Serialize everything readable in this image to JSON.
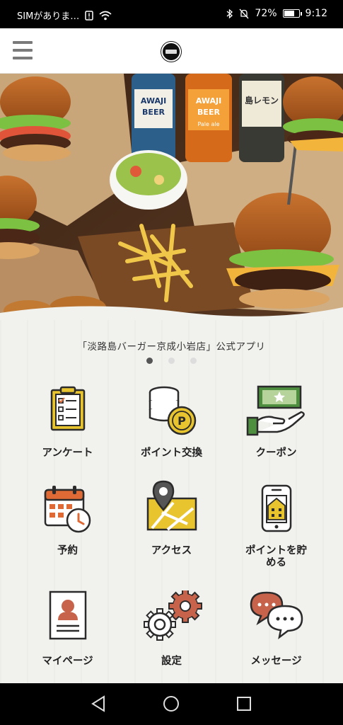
{
  "status_bar": {
    "carrier": "SIMがありま…",
    "battery": "72%",
    "battery_level": 0.72,
    "time": "9:12"
  },
  "app_header": {
    "menu_icon": "hamburger-menu-icon",
    "logo": "awaji-burger-logo"
  },
  "hero": {
    "bottles": [
      {
        "line1": "AWAJI",
        "line2": "BEER"
      },
      {
        "line1": "AWAJI",
        "line2": "BEER",
        "sub": "Pale ale"
      },
      {
        "line1": "島レモン"
      }
    ]
  },
  "tagline": "「淡路島バーガー京成小岩店」公式アプリ",
  "carousel": {
    "count": 3,
    "active": 0
  },
  "menu": [
    {
      "label": "アンケート",
      "icon": "survey-clipboard-icon"
    },
    {
      "label": "ポイント交換",
      "icon": "point-exchange-coins-icon"
    },
    {
      "label": "クーポン",
      "icon": "coupon-hand-icon"
    },
    {
      "label": "予約",
      "icon": "reservation-calendar-icon"
    },
    {
      "label": "アクセス",
      "icon": "access-map-pin-icon"
    },
    {
      "label": "ポイントを貯める",
      "label_line1": "ポイントを貯",
      "label_line2": "める",
      "icon": "collect-points-phone-icon"
    },
    {
      "label": "マイページ",
      "icon": "my-page-profile-icon"
    },
    {
      "label": "設定",
      "icon": "settings-gears-icon"
    },
    {
      "label": "メッセージ",
      "icon": "message-bubbles-icon"
    }
  ],
  "nav_bar": {
    "back": "back-triangle-icon",
    "home": "home-circle-icon",
    "recents": "recents-square-icon"
  },
  "colors": {
    "icon_yellow": "#e8c42e",
    "icon_orange": "#e06a35",
    "icon_green": "#4e8e3f",
    "icon_brown_red": "#c7634a",
    "icon_outline": "#2b2b2b"
  }
}
